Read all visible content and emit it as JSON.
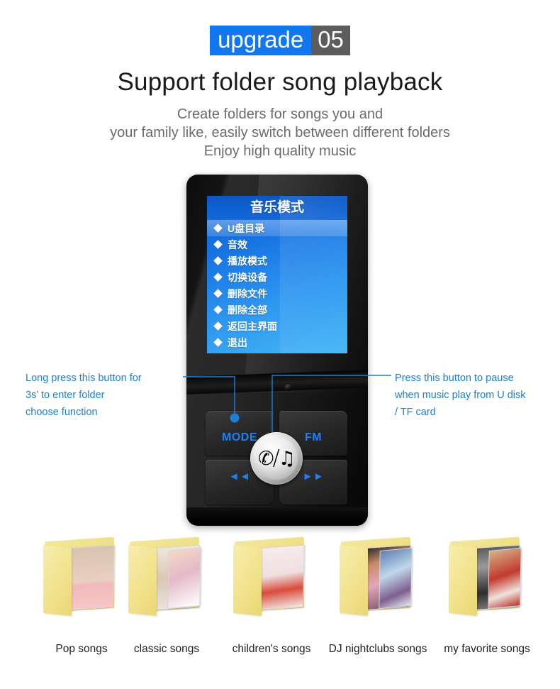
{
  "badge": {
    "label": "upgrade",
    "number": "05",
    "accent_color": "#1177ee",
    "number_bg_color": "#5c5c5c"
  },
  "heading": {
    "title": "Support  folder song playback",
    "subtitle_lines": [
      "Create folders for songs you and",
      "your family like, easily switch between different folders",
      "Enjoy high quality music"
    ]
  },
  "device": {
    "screen": {
      "title": "音乐模式",
      "menu_items": [
        {
          "label": "U盘目录",
          "selected": true
        },
        {
          "label": "音效",
          "selected": false
        },
        {
          "label": "播放模式",
          "selected": false
        },
        {
          "label": "切换设备",
          "selected": false
        },
        {
          "label": "删除文件",
          "selected": false
        },
        {
          "label": "删除全部",
          "selected": false
        },
        {
          "label": "返回主界面",
          "selected": false
        },
        {
          "label": "退出",
          "selected": false
        }
      ]
    },
    "keys": {
      "mode": "MODE",
      "fm": "FM",
      "prev": "◄◄",
      "next": "►►",
      "center_glyph_left": "✆",
      "center_glyph_slash": "/",
      "center_glyph_right": "♫"
    }
  },
  "callouts": {
    "left": {
      "lines": [
        "Long press this button for",
        "3s’ to enter folder",
        " choose function"
      ],
      "color": "#1b7fd4"
    },
    "right": {
      "lines": [
        "Press this button to pause",
        "when music play from U disk",
        "/ TF card"
      ],
      "color": "#1b7fd4"
    }
  },
  "folders": [
    {
      "label": "Pop songs",
      "art": "art-1",
      "art2": "art-2"
    },
    {
      "label": "classic songs",
      "art": "art-2",
      "art2": "art-2b"
    },
    {
      "label": "children's songs",
      "art": "art-3",
      "art2": "art-3"
    },
    {
      "label": "DJ nightclubs songs",
      "art": "art-4",
      "art2": "art-4b"
    },
    {
      "label": "my favorite songs",
      "art": "art-5",
      "art2": "art-5b"
    }
  ]
}
